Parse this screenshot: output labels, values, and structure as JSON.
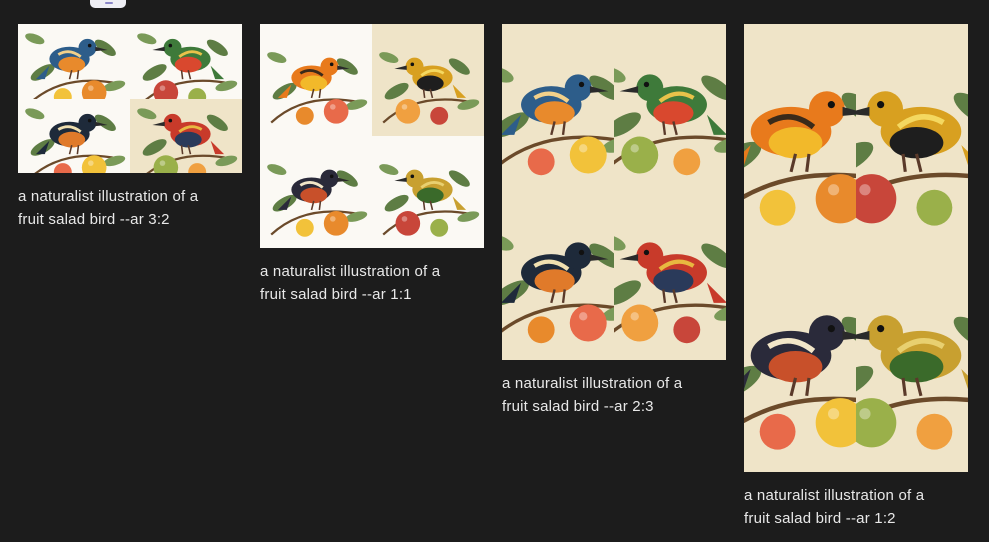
{
  "gallery": {
    "items": [
      {
        "caption": "a naturalist illustration of a\nfruit salad bird --ar 3:2",
        "aspect_ratio": "3:2"
      },
      {
        "caption": "a naturalist illustration of a\nfruit salad bird --ar 1:1",
        "aspect_ratio": "1:1"
      },
      {
        "caption": "a naturalist illustration of a\nfruit salad bird --ar 2:3",
        "aspect_ratio": "2:3"
      },
      {
        "caption": "a naturalist illustration of a\nfruit salad bird --ar 1:2",
        "aspect_ratio": "1:2"
      }
    ]
  },
  "colors": {
    "page_background": "#1c1c1c",
    "caption_text": "#e8e8e8",
    "paper_white": "#fbf9f4",
    "paper_cream": "#efe4c8",
    "leaf_green": "#5e7d44",
    "fruit_orange": "#e88a2c",
    "fruit_red": "#c8463a",
    "bird_blue": "#2d5d8a"
  },
  "icons": {
    "top_chip": "partial-button-icon",
    "tile_art": "bird-with-fruit-illustration"
  }
}
